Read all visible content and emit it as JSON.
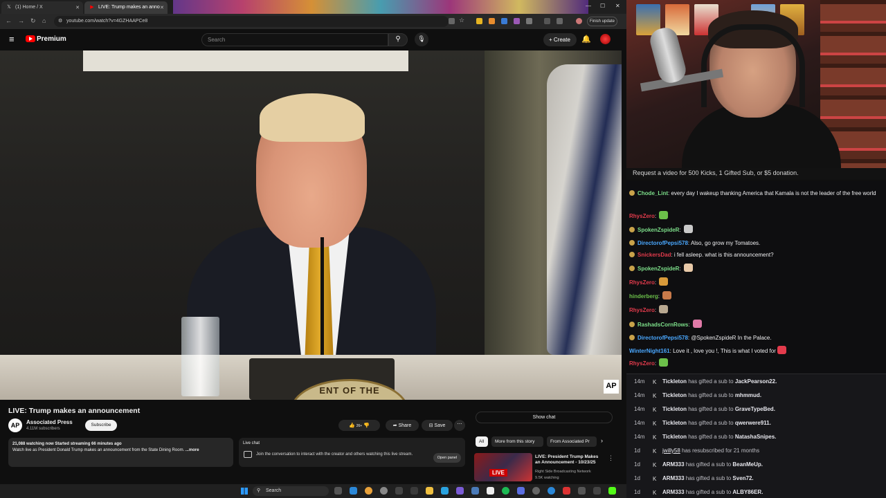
{
  "browser": {
    "tabs": [
      {
        "label": "(1) Home / X",
        "icon": "x-logo-icon"
      },
      {
        "label": "LIVE: Trump makes an anno",
        "icon": "youtube-icon"
      }
    ],
    "url": "youtube.com/watch?v=4GZHAAPCe8",
    "finish_update": "Finish update"
  },
  "youtube": {
    "logo": "Premium",
    "search_placeholder": "Search",
    "create_label": "Create",
    "video_title": "LIVE: Trump makes an announcement",
    "channel": {
      "name": "Associated Press",
      "subscribers": "4.11M subscribers",
      "icon_text": "AP"
    },
    "subscribe_label": "Subscribe",
    "like_count": "26+",
    "share_label": "Share",
    "save_label": "Save",
    "video_watermark": "AP",
    "seal_text": "ENT OF THE",
    "description": {
      "stats": "21,088 watching now  Started streaming 66 minutes ago",
      "text": "Watch live as President Donald Trump makes an announcement from the State Dining Room.",
      "more": "...more"
    },
    "live_chat": {
      "title": "Live chat",
      "description": "Join the conversation to interact with the creator and others watching this live stream.",
      "open_panel": "Open panel"
    },
    "show_chat": "Show chat",
    "chips": [
      "All",
      "More from this story",
      "From Associated Pr"
    ],
    "recommended": {
      "badge": "LIVE",
      "title": "LIVE: President Trump Makes an Announcement - 10/23/25",
      "channel": "Right Side Broadcasting Network",
      "watching": "9.5K watching"
    }
  },
  "taskbar": {
    "search": "Search"
  },
  "stream": {
    "request_banner": "Request a video for 500 Kicks, 1 Gifted Sub, or $5 donation.",
    "chat": [
      {
        "user": "Chode_Lint",
        "color": "#7ddf8a",
        "text": "every day I wakeup thanking America that Kamala is not the leader of the free world",
        "emote": ""
      },
      {
        "user": "RhysZero",
        "color": "#e33b4c",
        "text": "",
        "emote": "#6cc04a"
      },
      {
        "user": "SpokenZspideR",
        "color": "#7ddf8a",
        "text": "",
        "emote": "#c9c9c9"
      },
      {
        "user": "DirectorofPepsi578",
        "color": "#4aa8ff",
        "text": "Also, go grow my Tomatoes.",
        "emote": ""
      },
      {
        "user": "SnickersDad",
        "color": "#e33b4c",
        "text": "i fell asleep. what is this announcement?",
        "emote": ""
      },
      {
        "user": "SpokenZspideR",
        "color": "#7ddf8a",
        "text": "",
        "emote": "#e8c9a8"
      },
      {
        "user": "RhysZero",
        "color": "#e33b4c",
        "text": "",
        "emote": "#d89a3a"
      },
      {
        "user": "hinderberg",
        "color": "#6cc04a",
        "text": "",
        "emote": "#c87a4a"
      },
      {
        "user": "RhysZero",
        "color": "#e33b4c",
        "text": "",
        "emote": "#b8a890"
      },
      {
        "user": "RashadsCornRows",
        "color": "#7ddf8a",
        "text": "",
        "emote": "#e07aa8"
      },
      {
        "user": "DirectorofPepsi578",
        "color": "#4aa8ff",
        "text": "@SpokenZspideR In the Palace.",
        "emote": ""
      },
      {
        "user": "WinterNight161",
        "color": "#4aa8ff",
        "text": "Love it , love you !, This is what I voted for",
        "emote": "#e33b4c"
      },
      {
        "user": "RhysZero",
        "color": "#e33b4c",
        "text": "",
        "emote": "#6cc04a"
      }
    ],
    "events": [
      {
        "time": "14m",
        "user": "Tickleton",
        "action": "has gifted a sub to",
        "target": "JackPearson22."
      },
      {
        "time": "14m",
        "user": "Tickleton",
        "action": "has gifted a sub to",
        "target": "mhmmud."
      },
      {
        "time": "14m",
        "user": "Tickleton",
        "action": "has gifted a sub to",
        "target": "GraveTypeBed."
      },
      {
        "time": "14m",
        "user": "Tickleton",
        "action": "has gifted a sub to",
        "target": "qwerwere911."
      },
      {
        "time": "14m",
        "user": "Tickleton",
        "action": "has gifted a sub to",
        "target": "NatashaSnipes."
      },
      {
        "time": "1d",
        "user": "jwilly58",
        "action": "has resubscribed for 21 months",
        "target": ""
      },
      {
        "time": "1d",
        "user": "ARM333",
        "action": "has gifted a sub to",
        "target": "BeanMeUp."
      },
      {
        "time": "1d",
        "user": "ARM333",
        "action": "has gifted a sub to",
        "target": "Sven72."
      },
      {
        "time": "1d",
        "user": "ARM333",
        "action": "has gifted a sub to",
        "target": "ALBY86ER."
      }
    ]
  }
}
